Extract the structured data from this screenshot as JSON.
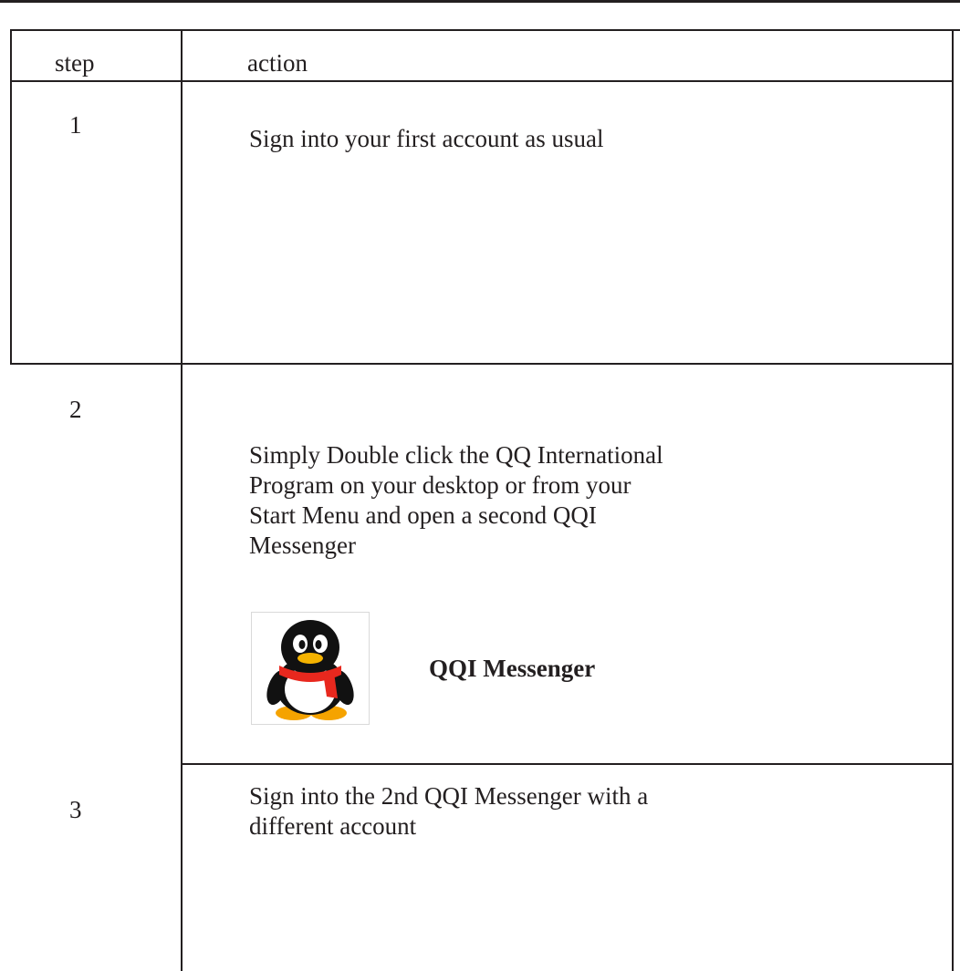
{
  "table": {
    "headers": {
      "step": "step",
      "action": "action"
    },
    "rows": [
      {
        "step": "1",
        "action_lines": [
          "Sign into your first account as usual"
        ]
      },
      {
        "step": "2",
        "action_lines": [
          "Simply Double click the QQ International",
          "Program on your desktop or from your",
          "Start Menu and open a second QQI",
          "Messenger"
        ]
      },
      {
        "step": "3",
        "action_lines": [
          "Sign into the 2nd QQI Messenger with a",
          "different account"
        ]
      }
    ]
  },
  "icon": {
    "name": "qq-penguin-icon",
    "caption": "QQI Messenger",
    "colors": {
      "body": "#111111",
      "belly": "#ffffff",
      "scarf": "#e8281e",
      "beak": "#f5b300",
      "feet": "#f5a300"
    }
  }
}
